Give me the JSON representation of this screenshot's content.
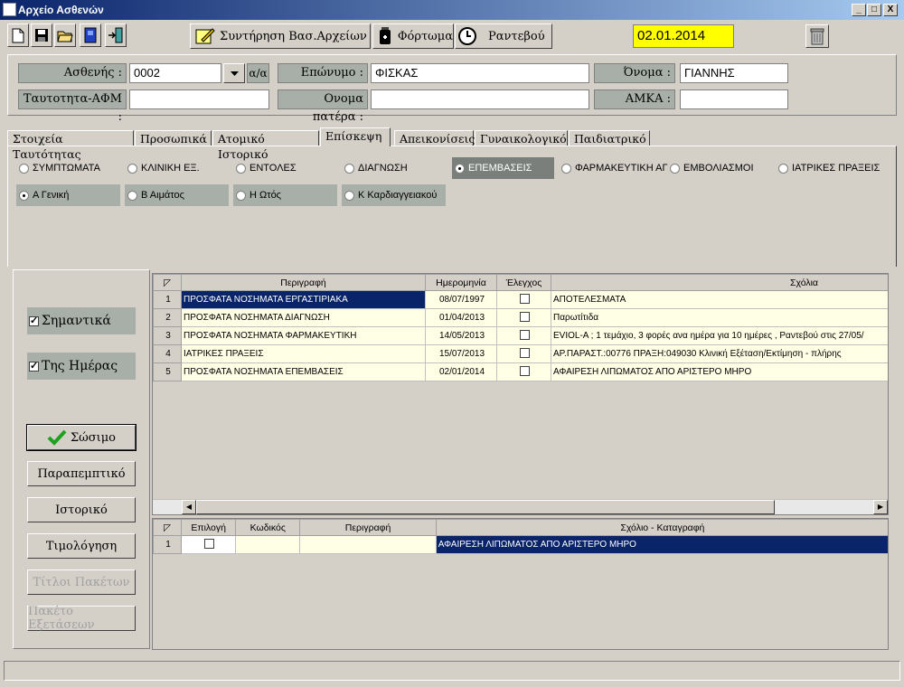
{
  "window": {
    "title": "Αρχείο Ασθενών",
    "min": "_",
    "max": "□",
    "close": "X"
  },
  "toolbar": {
    "maintenance": "Συντήρηση Βασ.Αρχείων",
    "load": "Φόρτωμα",
    "appointment": "Ραντεβού",
    "date": "02.01.2014"
  },
  "patient": {
    "patient_label": "Ασθενής :",
    "patient_value": "0002",
    "aa_label": "α/α",
    "surname_label": "Επώνυμο :",
    "surname_value": "ΦΙΣΚΑΣ",
    "name_label": "Όνομα :",
    "name_value": "ΓΙΑΝΝΗΣ",
    "id_label": "Ταυτοτητα-ΑΦΜ :",
    "id_value": "",
    "father_label": "Ονομα πατέρα :",
    "father_value": "",
    "amka_label": "ΑΜΚΑ :",
    "amka_value": ""
  },
  "tabs": [
    "Στοιχεία Ταυτότητας",
    "Προσωπικά",
    "Ατομικό Ιστορικό",
    "Επίσκεψη",
    "Απεικονίσεις",
    "Γυναικολογικό",
    "Παιδιατρικό"
  ],
  "active_tab": "Επίσκεψη",
  "categories": [
    "ΣΥΜΠΤΩΜΑΤΑ",
    "ΚΛΙΝΙΚΗ ΕΞ.",
    "ΕΝΤΟΛΕΣ",
    "ΔΙΑΓΝΩΣΗ",
    "ΕΠΕΜΒΑΣΕΙΣ",
    "ΦΑΡΜΑΚΕΥΤΙΚΗ ΑΓ",
    "ΕΜΒΟΛΙΑΣΜΟΙ",
    "ΙΑΤΡΙΚΕΣ ΠΡΑΞΕΙΣ"
  ],
  "selected_category": "ΕΠΕΜΒΑΣΕΙΣ",
  "subcategories": [
    "Α Γενική",
    "Β Αιμάτος",
    "Η Ωτός",
    "Κ Καρδιαγγειακού"
  ],
  "selected_subcategory": "Α Γενική",
  "left": {
    "important": "Σημαντικά",
    "today": "Της Ημέρας",
    "save": "Σώσιμο",
    "referral": "Παραπεμπτικό",
    "history": "Ιστορικό",
    "billing": "Τιμολόγηση",
    "package_titles": "Τίτλοι Πακέτων",
    "exam_package": "Πακέτο Εξετάσεων"
  },
  "grid1": {
    "columns": [
      "Περιγραφή",
      "Ημερομηνία",
      "Έλεγχος",
      "Σχόλια"
    ],
    "rows": [
      {
        "n": "1",
        "desc": "ΠΡΟΣΦΑΤΑ ΝΟΣΗΜΑΤΑ ΕΡΓΑΣΤΙΡΙΑΚΑ",
        "date": "08/07/1997",
        "check": false,
        "comment": "ΑΠΟΤΕΛΕΣΜΑΤΑ"
      },
      {
        "n": "2",
        "desc": "ΠΡΟΣΦΑΤΑ ΝΟΣΗΜΑΤΑ ΔΙΑΓΝΩΣΗ",
        "date": "01/04/2013",
        "check": false,
        "comment": "Παρωτίτιδα"
      },
      {
        "n": "3",
        "desc": "ΠΡΟΣΦΑΤΑ ΝΟΣΗΜΑΤΑ ΦΑΡΜΑΚΕΥΤΙΚΗ",
        "date": "14/05/2013",
        "check": false,
        "comment": "EVIOL-A ; 1 τεμάχιο, 3 φορές ανα ημέρα για 10 ημέρες , Ραντεβού στις 27/05/"
      },
      {
        "n": "4",
        "desc": "ΙΑΤΡΙΚΕΣ ΠΡΑΞΕΙΣ",
        "date": "15/07/2013",
        "check": false,
        "comment": "ΑΡ.ΠΑΡΑΣΤ.:00776 ΠΡΑΞΗ:049030 Κλινική Εξέταση/Εκτίμηση - πλήρης"
      },
      {
        "n": "5",
        "desc": "ΠΡΟΣΦΑΤΑ ΝΟΣΗΜΑΤΑ ΕΠΕΜΒΑΣΕΙΣ",
        "date": "02/01/2014",
        "check": false,
        "comment": "ΑΦΑΙΡΕΣΗ ΛΙΠΩΜΑΤΟΣ ΑΠΟ ΑΡΙΣΤΕΡΟ ΜΗΡΟ"
      }
    ]
  },
  "grid2": {
    "columns": [
      "Επιλογή",
      "Κωδικός",
      "Περιγραφή",
      "Σχόλιο - Καταγραφή"
    ],
    "rows": [
      {
        "n": "1",
        "select": false,
        "code": "",
        "desc": "",
        "comment": "ΑΦΑΙΡΕΣΗ ΛΙΠΩΜΑΤΟΣ ΑΠΟ ΑΡΙΣΤΕΡΟ ΜΗΡΟ"
      }
    ]
  }
}
